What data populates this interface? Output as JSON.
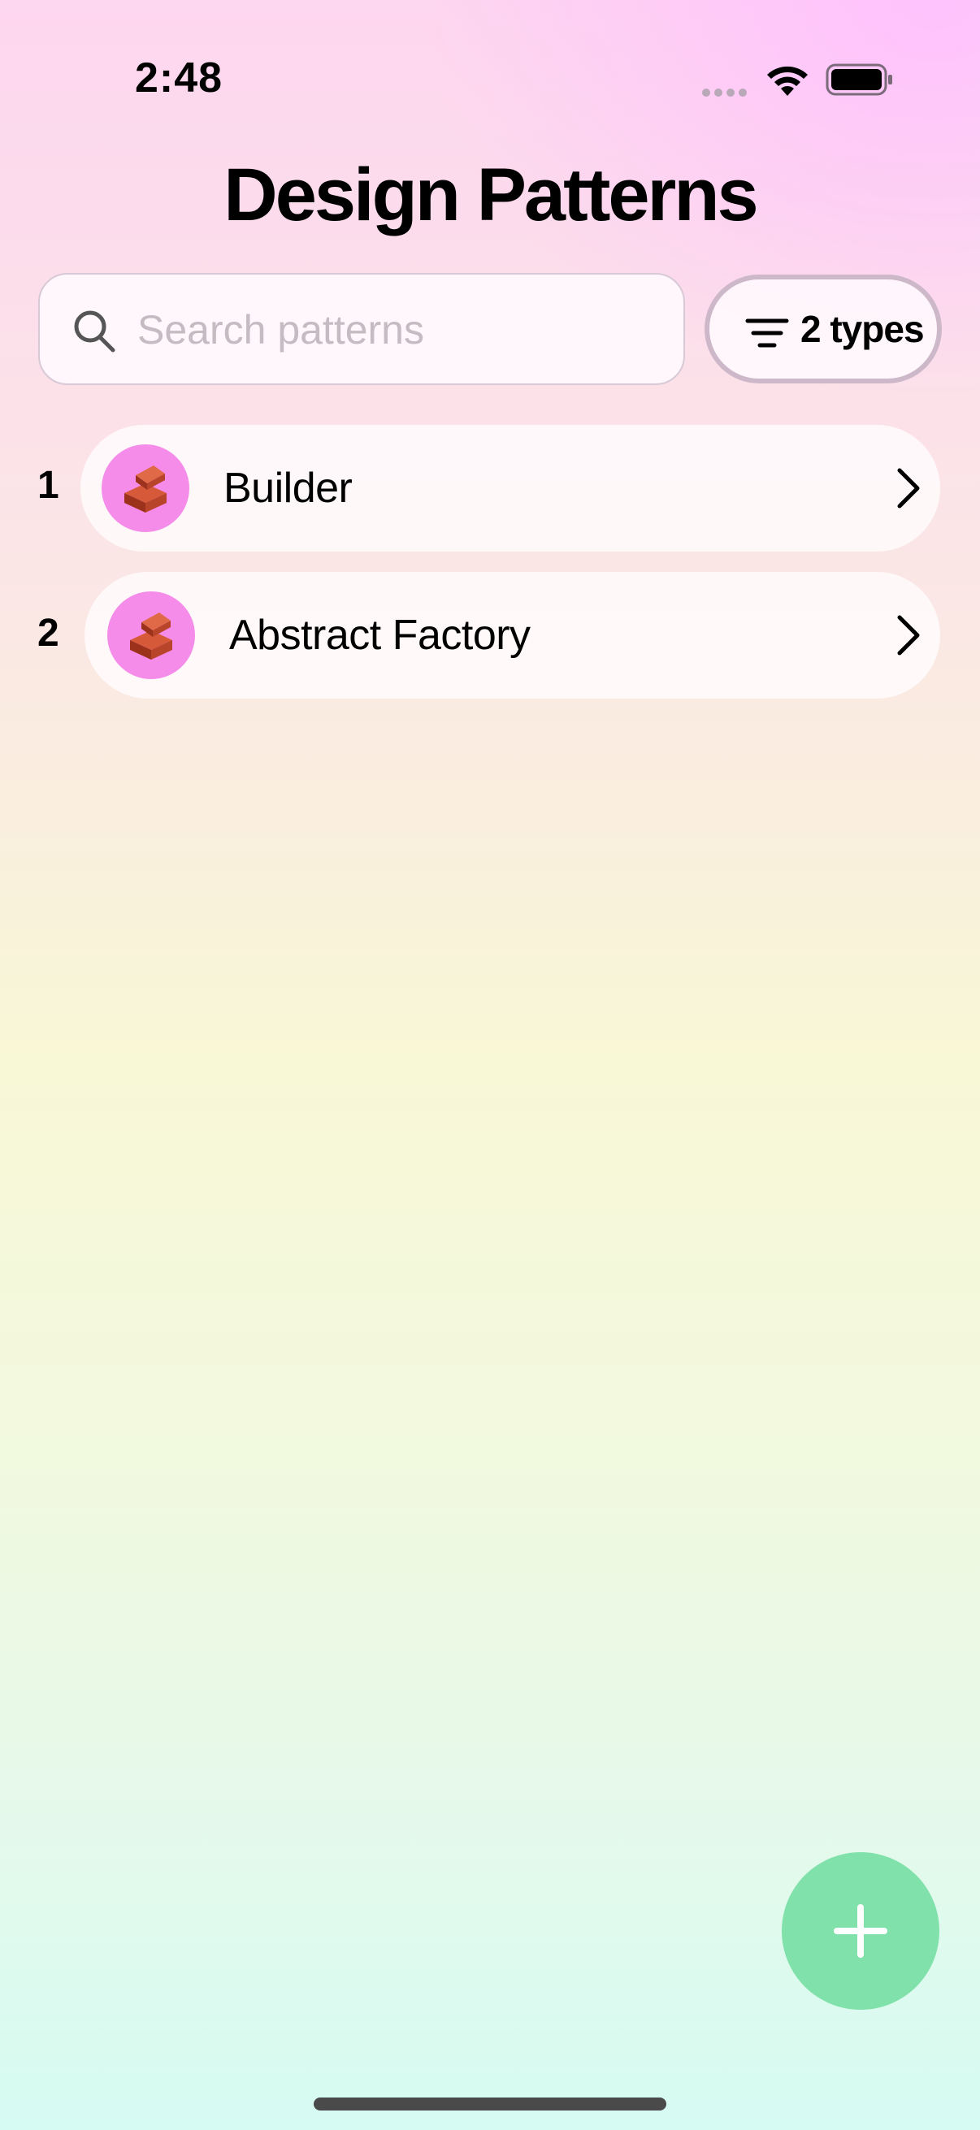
{
  "status_bar": {
    "time": "2:48",
    "icons": [
      "signal-dots-icon",
      "wifi-icon",
      "battery-icon"
    ]
  },
  "title": "Design Patterns",
  "search": {
    "placeholder": "Search patterns",
    "value": ""
  },
  "filter": {
    "label": "2 types",
    "icon": "filter-icon"
  },
  "patterns": [
    {
      "index": "1",
      "name": "Builder",
      "icon": "bricks-icon"
    },
    {
      "index": "2",
      "name": "Abstract Factory",
      "icon": "bricks-icon"
    }
  ],
  "fab": {
    "icon": "plus-icon"
  },
  "colors": {
    "icon_circle": "#f58ce9",
    "fab": "#80e2aa",
    "brick": "#b8442a"
  }
}
